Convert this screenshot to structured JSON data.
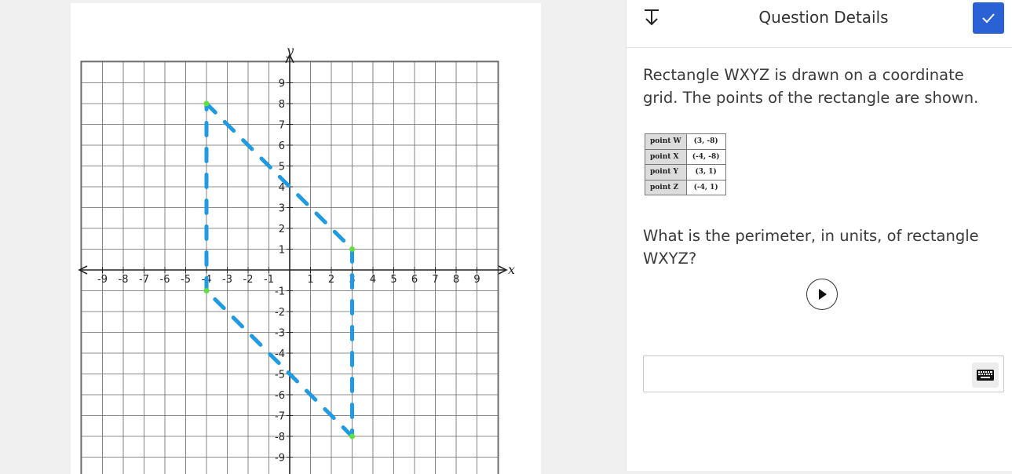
{
  "panel": {
    "title": "Question Details",
    "question_intro": "Rectangle WXYZ is drawn on a coordinate grid. The points of the rectangle are shown.",
    "question_prompt": "What is the perimeter, in units, of rectangle WXYZ?",
    "answer_value": "",
    "icons": {
      "collapse": "collapse-down-icon",
      "check": "check-icon",
      "play": "play-icon",
      "keyboard": "keyboard-icon"
    },
    "accent_color": "#2a62d6"
  },
  "points_table": [
    {
      "label": "point W",
      "value": "(3, -8)"
    },
    {
      "label": "point X",
      "value": "(-4, -8)"
    },
    {
      "label": "point Y",
      "value": "(3, 1)"
    },
    {
      "label": "point Z",
      "value": "(-4, 1)"
    }
  ],
  "graph": {
    "x_axis_label": "x",
    "y_axis_label": "y",
    "x_ticks": [
      "-9",
      "-8",
      "-7",
      "-6",
      "-5",
      "-4",
      "-3",
      "-2",
      "-1",
      "1",
      "2",
      "3",
      "4",
      "5",
      "6",
      "7",
      "8",
      "9"
    ],
    "y_ticks": [
      "9",
      "8",
      "7",
      "6",
      "5",
      "4",
      "3",
      "2",
      "1",
      "-1",
      "-2",
      "-3",
      "-4",
      "-5",
      "-6",
      "-7",
      "-8",
      "-9"
    ],
    "line_color": "#1e9be2",
    "point_color": "#5fe03a",
    "annotation_points": [
      {
        "x": -4,
        "y": 8
      },
      {
        "x": 3,
        "y": 1
      },
      {
        "x": -4,
        "y": -1
      },
      {
        "x": 3,
        "y": -8
      }
    ]
  }
}
